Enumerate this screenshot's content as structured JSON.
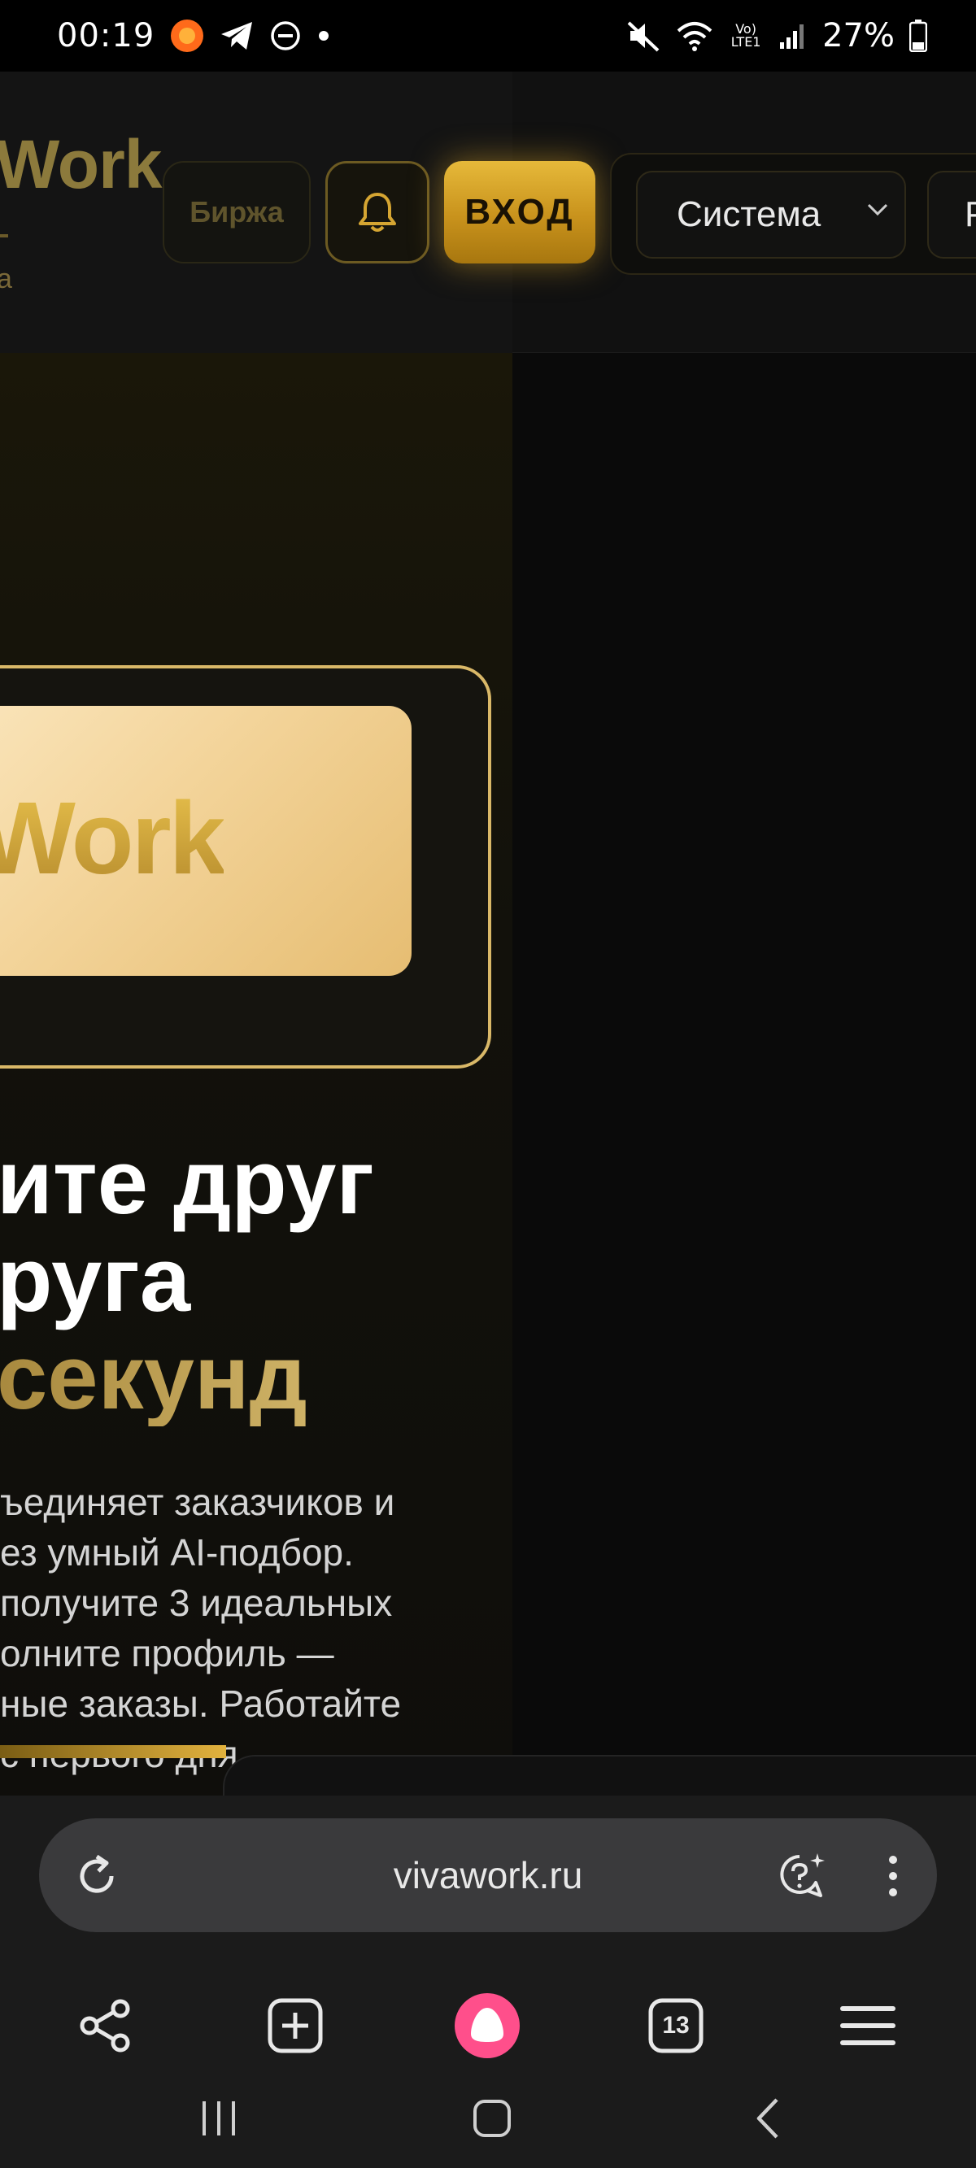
{
  "status_bar": {
    "time": "00:19",
    "battery": "27%",
    "network_label": "Vo) LTE1",
    "icons": [
      "app-orange-icon",
      "telegram-icon",
      "do-not-disturb-icon",
      "dot-icon",
      "mute-icon",
      "wifi-icon",
      "signal-icon",
      "battery-icon"
    ]
  },
  "site": {
    "logo": "Work",
    "logo_sub": "а",
    "nav": {
      "exchange_label": "Биржа",
      "login_label": "ВХОД",
      "bell": "bell-icon"
    },
    "selects": {
      "system_label": "Система",
      "second_label": "Р"
    },
    "hero": {
      "card_text": "Work",
      "title_line1": "ите друг",
      "title_line2": "руга",
      "title_line3": "секунд",
      "description": "ъединяет заказчиков и\nез умный AI-подбор.\nполучите 3 идеальных\nолните профиль —\nные заказы. Работайте\nс первого дня."
    }
  },
  "browser": {
    "url": "vivawork.ru",
    "tabs_count": "13"
  },
  "colors": {
    "gold_accent": "#d9b868",
    "login_button": "#d4a02a",
    "alice_pink": "#ff4f8b"
  }
}
